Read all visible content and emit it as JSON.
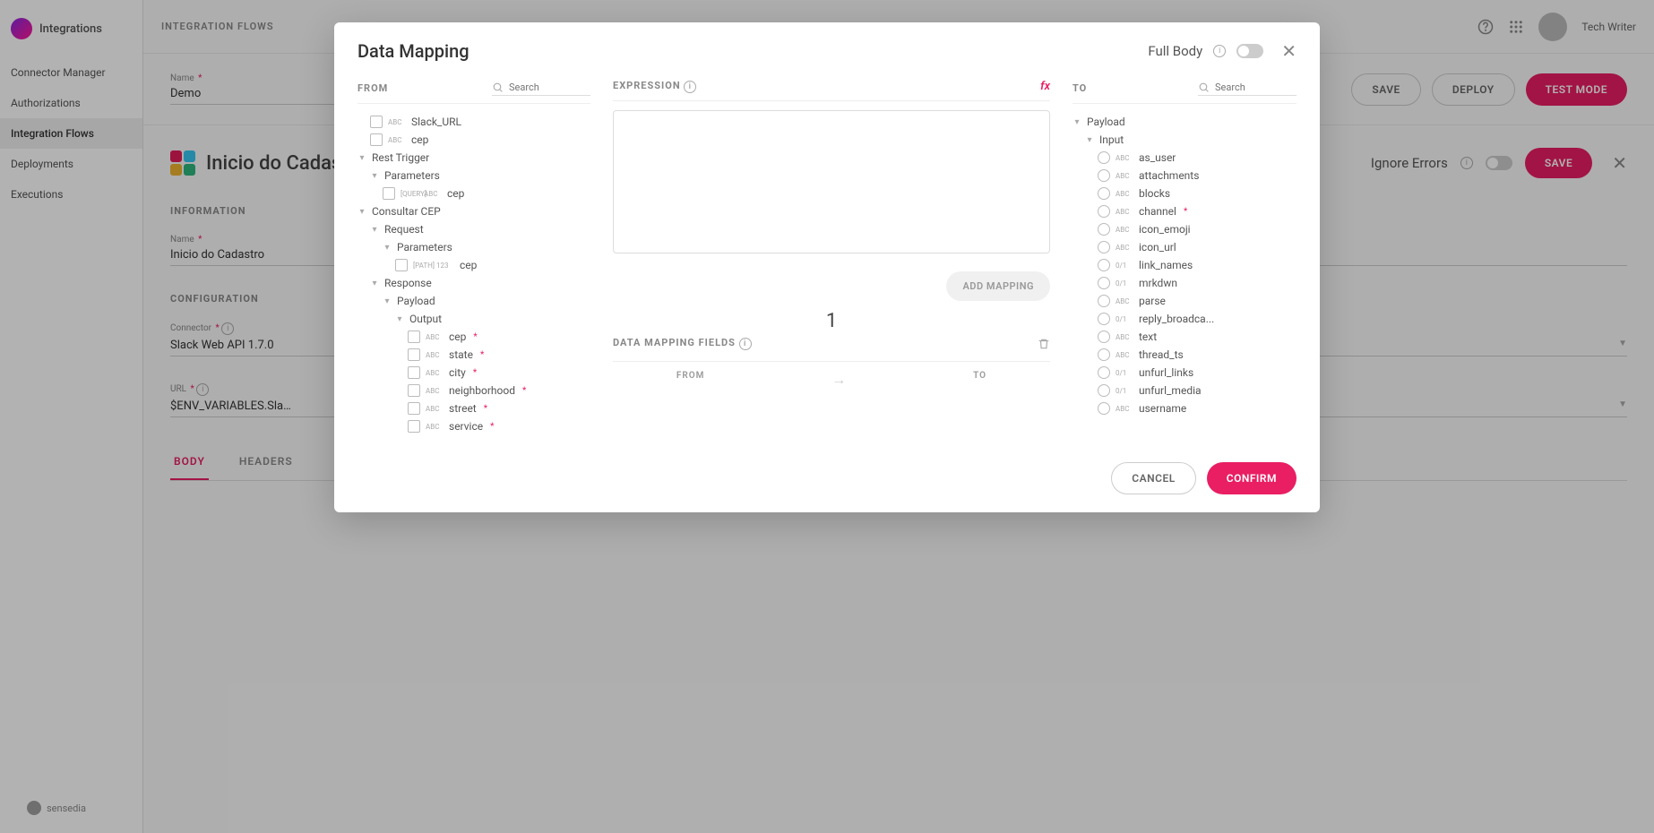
{
  "brand": {
    "name": "Integrations",
    "bottom": "sensedia"
  },
  "sidebar": {
    "items": [
      {
        "label": "Connector Manager"
      },
      {
        "label": "Authorizations"
      },
      {
        "label": "Integration Flows"
      },
      {
        "label": "Deployments"
      },
      {
        "label": "Executions"
      }
    ]
  },
  "breadcrumb": "INTEGRATION FLOWS",
  "header": {
    "user": "Tech Writer"
  },
  "topForm": {
    "nameLabel": "Name",
    "nameValue": "Demo",
    "save": "SAVE",
    "deploy": "DEPLOY",
    "testMode": "TEST MODE"
  },
  "flow": {
    "title": "Inicio do Cadastro",
    "ignoreErrors": "Ignore Errors",
    "save": "SAVE",
    "informationTitle": "INFORMATION",
    "infoName": {
      "label": "Name",
      "value": "Inicio do Cadastro"
    },
    "configurationTitle": "CONFIGURATION",
    "connector": {
      "label": "Connector",
      "value": "Slack Web API 1.7.0"
    },
    "url": {
      "label": "URL",
      "value": "$ENV_VARIABLES.Sla…"
    },
    "tabs": {
      "body": "BODY",
      "headers": "HEADERS"
    }
  },
  "modal": {
    "title": "Data Mapping",
    "fullBody": "Full Body",
    "from": "FROM",
    "expression": "EXPRESSION",
    "to": "TO",
    "searchPlaceholder": "Search",
    "addMapping": "ADD MAPPING",
    "bigNumber": "1",
    "fieldsTitle": "DATA MAPPING FIELDS",
    "fieldsFrom": "FROM",
    "fieldsTo": "TO",
    "cancel": "CANCEL",
    "confirm": "CONFIRM",
    "fromTree": {
      "slackUrl": {
        "type": "ABC",
        "label": "Slack_URL"
      },
      "cep0": {
        "type": "ABC",
        "label": "cep"
      },
      "restTrigger": "Rest Trigger",
      "parameters1": "Parameters",
      "queryCep": {
        "prefix": "[QUERY]",
        "type": "ABC",
        "label": "cep"
      },
      "consultarCep": "Consultar CEP",
      "request": "Request",
      "parameters2": "Parameters",
      "pathCep": {
        "prefix": "[PATH]",
        "type": "123",
        "label": "cep"
      },
      "response": "Response",
      "payload": "Payload",
      "output": "Output",
      "outCep": {
        "type": "ABC",
        "label": "cep"
      },
      "outState": {
        "type": "ABC",
        "label": "state"
      },
      "outCity": {
        "type": "ABC",
        "label": "city"
      },
      "outNeighborhood": {
        "type": "ABC",
        "label": "neighborhood"
      },
      "outStreet": {
        "type": "ABC",
        "label": "street"
      },
      "outService": {
        "type": "ABC",
        "label": "service"
      }
    },
    "toTree": {
      "payload": "Payload",
      "input": "Input",
      "asUser": {
        "type": "ABC",
        "label": "as_user"
      },
      "attachments": {
        "type": "ABC",
        "label": "attachments"
      },
      "blocks": {
        "type": "ABC",
        "label": "blocks"
      },
      "channel": {
        "type": "ABC",
        "label": "channel"
      },
      "iconEmoji": {
        "type": "ABC",
        "label": "icon_emoji"
      },
      "iconUrl": {
        "type": "ABC",
        "label": "icon_url"
      },
      "linkNames": {
        "type": "0/1",
        "label": "link_names"
      },
      "mrkdwn": {
        "type": "0/1",
        "label": "mrkdwn"
      },
      "parse": {
        "type": "ABC",
        "label": "parse"
      },
      "replyBroadcast": {
        "type": "0/1",
        "label": "reply_broadca..."
      },
      "text": {
        "type": "ABC",
        "label": "text"
      },
      "threadTs": {
        "type": "ABC",
        "label": "thread_ts"
      },
      "unfurlLinks": {
        "type": "0/1",
        "label": "unfurl_links"
      },
      "unfurlMedia": {
        "type": "0/1",
        "label": "unfurl_media"
      },
      "username": {
        "type": "ABC",
        "label": "username"
      }
    }
  }
}
